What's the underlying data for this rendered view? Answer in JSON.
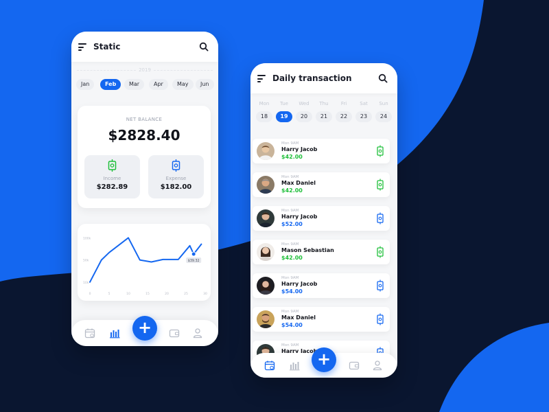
{
  "colors": {
    "accent": "#1467f0",
    "background_dark": "#0a1630",
    "background_blue": "#1467f0",
    "income_green": "#1fbf3a",
    "expense_blue": "#1467f0"
  },
  "statistics_screen": {
    "title": "Static",
    "year": "2019",
    "months": [
      "Jan",
      "Feb",
      "Mar",
      "Apr",
      "May",
      "Jun"
    ],
    "active_month": "Feb",
    "net_balance_label": "NET BALANCE",
    "net_balance_value": "$2828.40",
    "income": {
      "label": "Income",
      "value": "$282.89",
      "icon": "money-in-icon"
    },
    "expense": {
      "label": "Expense",
      "value": "$182.00",
      "icon": "money-out-icon"
    },
    "nav": [
      "calendar-icon",
      "chart-bars-icon",
      "add-icon",
      "wallet-icon",
      "user-icon"
    ]
  },
  "chart_data": {
    "type": "line",
    "title": "",
    "xlabel": "",
    "ylabel": "",
    "x": [
      0,
      3,
      5,
      10,
      13,
      16,
      19,
      23,
      26,
      29
    ],
    "y_tick_labels": [
      "10k",
      "50k",
      "100k"
    ],
    "x_tick_labels": [
      "0",
      "5",
      "10",
      "15",
      "20",
      "25",
      "30"
    ],
    "series": [
      {
        "values": [
          10,
          55,
          70,
          100,
          55,
          51,
          56,
          56,
          84,
          67,
          87
        ]
      }
    ],
    "x_points": [
      0,
      3,
      5,
      10,
      13,
      16,
      19,
      23,
      26,
      27,
      29
    ],
    "ylim": [
      0,
      120
    ],
    "highlight": {
      "x": 27,
      "label": "$39.32"
    },
    "grid": false
  },
  "transactions_screen": {
    "title": "Daily transaction",
    "weekdays": [
      "Mon",
      "Tue",
      "Wed",
      "Thu",
      "Fri",
      "Sat",
      "Sun"
    ],
    "days": [
      "18",
      "19",
      "20",
      "21",
      "22",
      "23",
      "24"
    ],
    "active_day": "19",
    "transactions": [
      {
        "time": "Mon 9AM",
        "name": "Harry Jacob",
        "amount": "$42.00",
        "type": "income"
      },
      {
        "time": "Mon 9AM",
        "name": "Max Daniel",
        "amount": "$42.00",
        "type": "income"
      },
      {
        "time": "Mon 9AM",
        "name": "Harry Jacob",
        "amount": "$52.00",
        "type": "expense"
      },
      {
        "time": "Mon 9AM",
        "name": "Mason Sebastian",
        "amount": "$42.00",
        "type": "income"
      },
      {
        "time": "Mon 9AM",
        "name": "Harry Jacob",
        "amount": "$54.00",
        "type": "expense"
      },
      {
        "time": "Mon 9AM",
        "name": "Max Daniel",
        "amount": "$54.00",
        "type": "expense"
      },
      {
        "time": "Mon 9AM",
        "name": "Harry Jacob",
        "amount": "",
        "type": "expense"
      }
    ],
    "nav": [
      "calendar-icon",
      "chart-bars-icon",
      "add-icon",
      "wallet-icon",
      "user-icon"
    ]
  }
}
